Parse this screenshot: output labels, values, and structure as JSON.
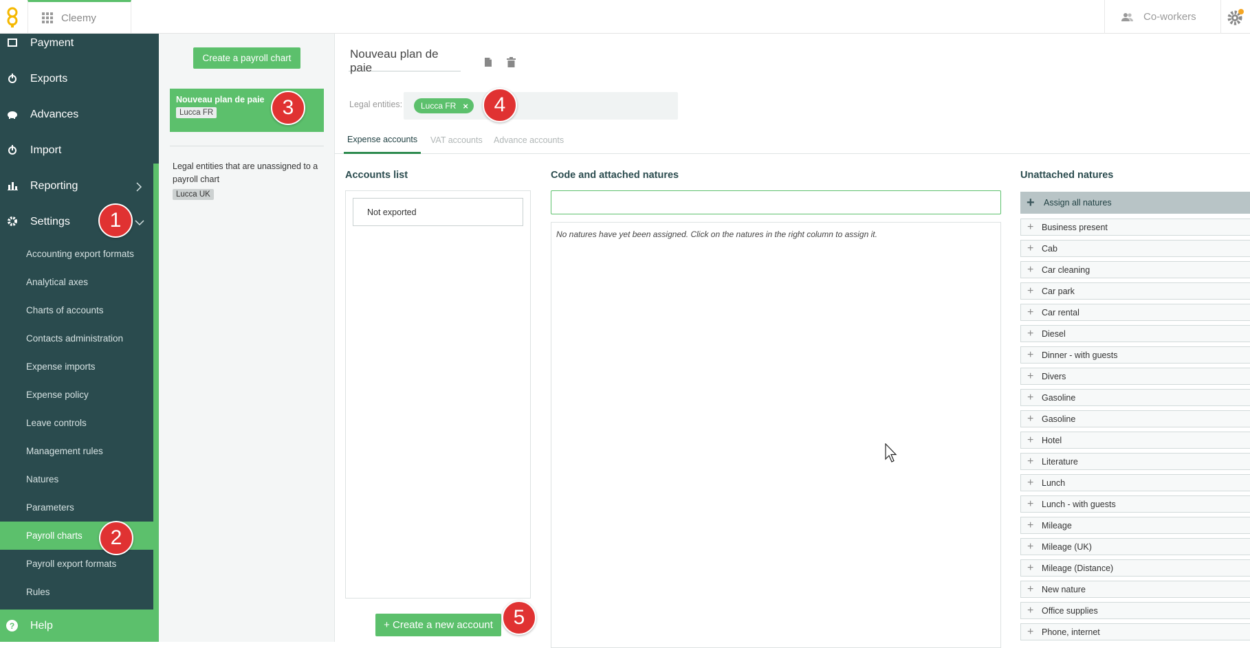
{
  "topbar": {
    "app_name": "Cleemy",
    "coworkers_label": "Co-workers"
  },
  "sidebar": {
    "main_items": [
      {
        "label": "Payment",
        "icon": "payment-icon"
      },
      {
        "label": "Exports",
        "icon": "export-icon"
      },
      {
        "label": "Advances",
        "icon": "piggy-bank-icon"
      },
      {
        "label": "Import",
        "icon": "import-icon"
      },
      {
        "label": "Reporting",
        "icon": "bar-chart-icon"
      },
      {
        "label": "Settings",
        "icon": "gear-icon"
      }
    ],
    "settings_items": [
      "Accounting export formats",
      "Analytical axes",
      "Charts of accounts",
      "Contacts administration",
      "Expense imports",
      "Expense policy",
      "Leave controls",
      "Management rules",
      "Natures",
      "Parameters",
      "Payroll charts",
      "Payroll export formats",
      "Rules"
    ],
    "active_item": "Payroll charts",
    "help_label": "Help"
  },
  "charts_panel": {
    "create_button": "Create a payroll chart",
    "chart_name": "Nouveau plan de paie",
    "chart_entity": "Lucca FR",
    "unassigned_text": "Legal entities that are unassigned to a payroll chart",
    "unassigned_entity": "Lucca UK"
  },
  "editor": {
    "title_value": "Nouveau plan de paie",
    "legal_entities_label": "Legal entities:",
    "legal_entity_tag": "Lucca FR",
    "tabs": [
      "Expense accounts",
      "VAT accounts",
      "Advance accounts"
    ],
    "active_tab": "Expense accounts",
    "accounts_list_heading": "Accounts list",
    "not_exported": "Not exported",
    "code_heading": "Code and attached natures",
    "empty_message": "No natures have yet been assigned. Click on the natures in the right column to assign it.",
    "new_account_button": "+ Create a new account",
    "unattached_heading": "Unattached natures",
    "assign_all": "Assign all natures",
    "natures": [
      "Business present",
      "Cab",
      "Car cleaning",
      "Car park",
      "Car rental",
      "Diesel",
      "Dinner - with guests",
      "Divers",
      "Gasoline",
      "Gasoline",
      "Hotel",
      "Literature",
      "Lunch",
      "Lunch - with guests",
      "Mileage",
      "Mileage (UK)",
      "Mileage (Distance)",
      "New nature",
      "Office supplies",
      "Phone, internet"
    ]
  },
  "annotations": [
    "1",
    "2",
    "3",
    "4",
    "5"
  ],
  "colors": {
    "sidebar": "#2a4b4e",
    "accent": "#5cc06c",
    "badge": "#e03232",
    "notification": "#f5a623"
  }
}
